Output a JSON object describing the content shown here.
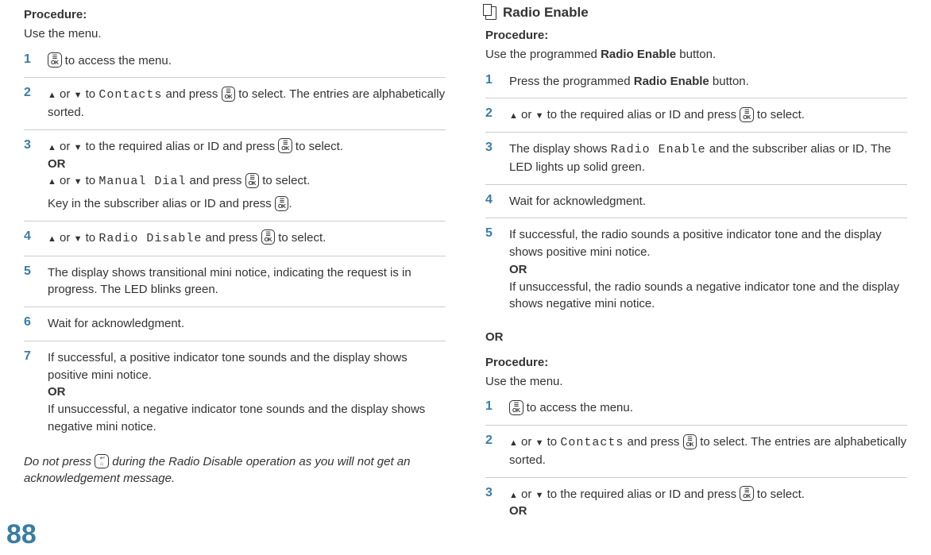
{
  "page_number": "88",
  "left": {
    "procedure_label": "Procedure:",
    "procedure_intro": "Use the menu.",
    "steps": [
      {
        "num": "1",
        "pre": "",
        "post": " to access the menu.",
        "show_ok_start": true
      },
      {
        "num": "2",
        "text_a": " or ",
        "text_b": " to ",
        "mono": "Contacts",
        "text_c": " and press ",
        "text_d": " to select. The entries are alphabetically sorted."
      },
      {
        "num": "3",
        "line1_a": " or ",
        "line1_b": " to the required alias or ID and press ",
        "line1_c": " to select.",
        "or": "OR",
        "line2_a": " or ",
        "line2_b": " to ",
        "mono2": "Manual Dial",
        "line2_c": " and press ",
        "line2_d": " to select.",
        "line3_a": "Key in the subscriber alias or ID and press ",
        "line3_b": "."
      },
      {
        "num": "4",
        "a": " or ",
        "b": " to ",
        "mono": "Radio Disable",
        "c": " and press ",
        "d": " to select."
      },
      {
        "num": "5",
        "text": " The display shows transitional mini notice, indicating the request is in progress. The LED blinks green."
      },
      {
        "num": "6",
        "text": "Wait for acknowledgment."
      },
      {
        "num": "7",
        "text_a": "If successful, a positive indicator tone sounds and the display shows positive mini notice.",
        "or": "OR",
        "text_b": "If unsuccessful, a negative indicator tone sounds and the display shows negative mini notice."
      }
    ],
    "footnote_a": "Do not press ",
    "footnote_b": " during the Radio Disable operation as you will not get an acknowledgement message."
  },
  "right": {
    "heading": "Radio Enable",
    "procedure_label": "Procedure:",
    "procedure_intro_a": "Use the programmed ",
    "procedure_intro_b": "Radio Enable",
    "procedure_intro_c": " button.",
    "steps_a": [
      {
        "num": "1",
        "a": "Press the programmed ",
        "b": "Radio Enable",
        "c": " button."
      },
      {
        "num": "2",
        "a": " or ",
        "b": " to the required alias or ID and press ",
        "c": " to select."
      },
      {
        "num": "3",
        "a": " The display shows ",
        "mono": "Radio Enable",
        "b": " and the subscriber alias or ID. The LED lights up solid green."
      },
      {
        "num": "4",
        "a": "Wait for acknowledgment."
      },
      {
        "num": "5",
        "a": "If successful, the radio sounds a positive indicator tone and the display shows positive mini notice.",
        "or": "OR",
        "b": "If unsuccessful, the radio sounds a negative indicator tone and the display shows negative mini notice."
      }
    ],
    "or_sep": "OR",
    "procedure_label2": "Procedure:",
    "procedure_intro2": "Use the menu.",
    "steps_b": [
      {
        "num": "1",
        "a": " to access the menu."
      },
      {
        "num": "2",
        "a": " or ",
        "b": " to ",
        "mono": "Contacts",
        "c": " and press ",
        "d": " to select. The entries are alphabetically sorted."
      },
      {
        "num": "3",
        "a": " or ",
        "b": " to the required alias or ID and press ",
        "c": " to select.",
        "or": "OR"
      }
    ]
  }
}
